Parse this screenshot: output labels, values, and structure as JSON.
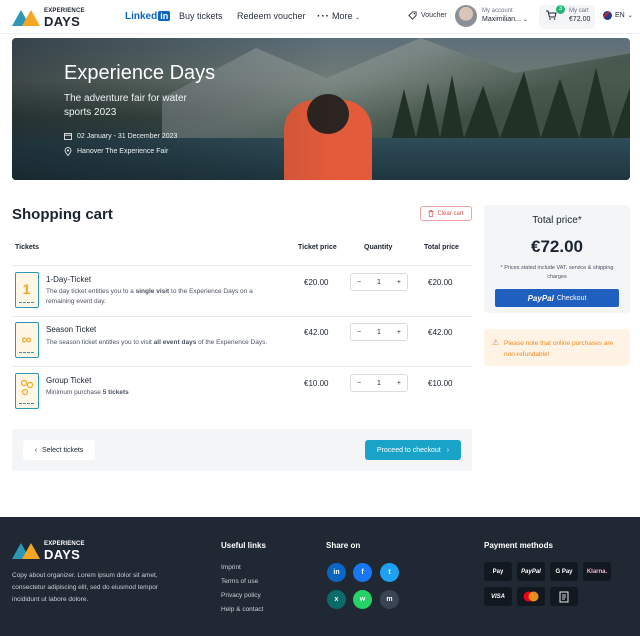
{
  "header": {
    "logo_small": "EXPERIENCE",
    "logo_big": "DAYS",
    "nav": {
      "linkedin_text": "Linked",
      "linkedin_in": "in",
      "buy_tickets": "Buy tickets",
      "redeem_voucher": "Redeem voucher",
      "more": "More"
    },
    "voucher": "Voucher",
    "account": {
      "label": "My account",
      "name": "Maximilian..."
    },
    "cart": {
      "label": "My cart",
      "count": "3",
      "total": "€72.00"
    },
    "language": "EN"
  },
  "hero": {
    "title": "Experience Days",
    "subtitle": "The adventure fair for water sports 2023",
    "date": "02 January - 31 December 2023",
    "location": "Hanover The Experience Fair"
  },
  "cart": {
    "title": "Shopping cart",
    "clear_label": "Clear cart",
    "columns": {
      "tickets": "Tickets",
      "price": "Ticket price",
      "quantity": "Quantity",
      "total": "Total price"
    },
    "items": [
      {
        "name": "1-Day-Ticket",
        "desc_pre": "The day ticket entitles you to a ",
        "desc_bold": "single visit",
        "desc_post": " to the Experience Days on a remaining event day.",
        "price": "€20.00",
        "qty": "1",
        "total": "€20.00",
        "icon": "1"
      },
      {
        "name": "Season Ticket",
        "desc_pre": "The season ticket entitles you to visit ",
        "desc_bold": "all event days",
        "desc_post": " of the Experience Days.",
        "price": "€42.00",
        "qty": "1",
        "total": "€42.00",
        "icon": "∞"
      },
      {
        "name": "Group Ticket",
        "desc_pre": "Minimum purchase ",
        "desc_bold": "5 tickets",
        "desc_post": "",
        "price": "€10.00",
        "qty": "1",
        "total": "€10.00",
        "icon": "group"
      }
    ],
    "select_tickets": "Select tickets",
    "proceed": "Proceed to checkout"
  },
  "summary": {
    "label": "Total price*",
    "value": "€72.00",
    "note": "* Prices stated include VAT, service & shipping charges",
    "paypal_brand": "PayPal",
    "paypal_label": "Checkout",
    "notice": "Please note that online purchases are non-refundable!"
  },
  "footer": {
    "logo_small": "EXPERIENCE",
    "logo_big": "DAYS",
    "copy": "Copy about organizer. Lorem ipsum dolor sit amet, consectetur adipiscing elit, sed do eiusmod tempor incididunt ut labore dolore.",
    "useful_links_title": "Useful links",
    "links": [
      "Imprint",
      "Terms of use",
      "Privacy policy",
      "Help & contact"
    ],
    "share_title": "Share on",
    "share": [
      "in",
      "f",
      "t",
      "x",
      "w",
      "m"
    ],
    "payment_title": "Payment methods",
    "payments": [
      "Pay",
      "PayPal",
      "G Pay",
      "Klarna.",
      "VISA",
      "mc",
      "inv"
    ]
  },
  "colors": {
    "accent": "#19a3c8",
    "paypal": "#1f5fbf",
    "warning": "#f08a24",
    "footer": "#1f2833",
    "danger": "#d9534f"
  }
}
